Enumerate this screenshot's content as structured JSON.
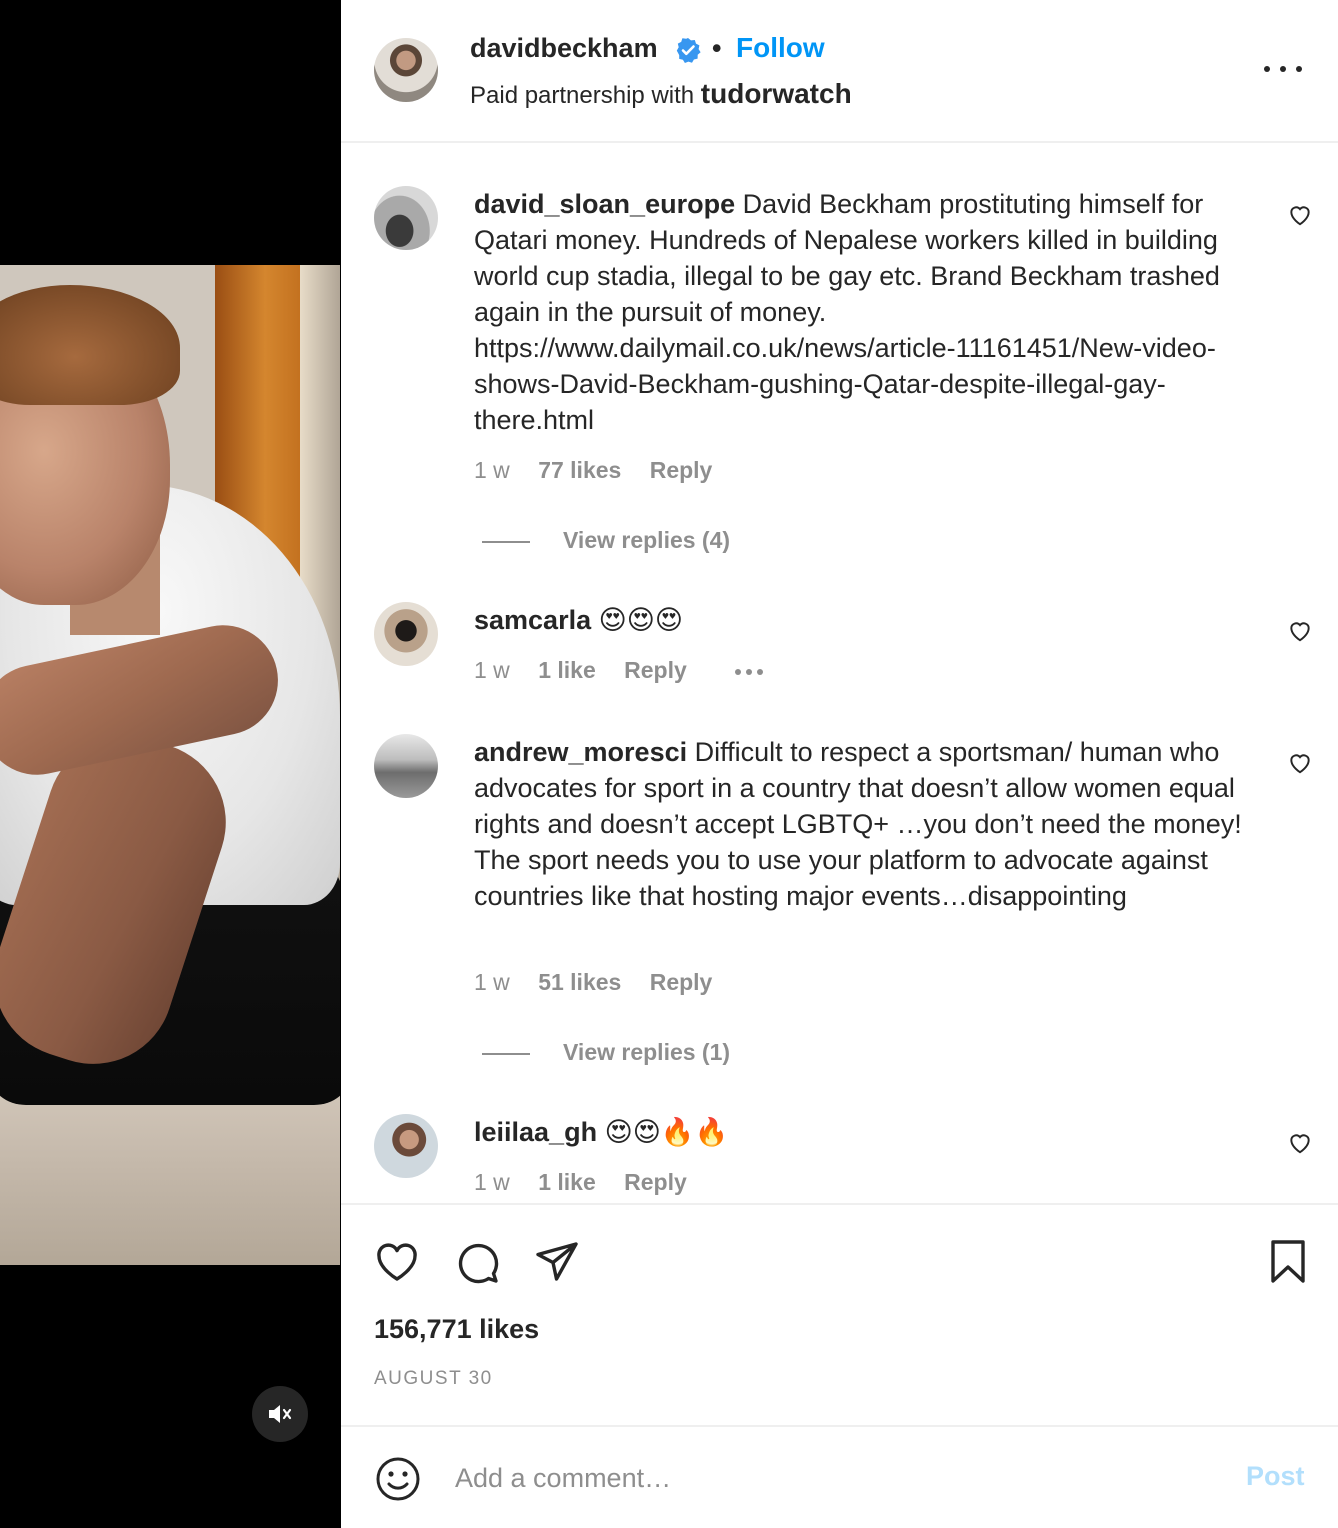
{
  "post": {
    "author": "davidbeckham",
    "follow_label": "Follow",
    "separator": "•",
    "partnership_prefix": "Paid partnership with",
    "partner": "tudorwatch"
  },
  "comments": [
    {
      "username": "david_sloan_europe",
      "text": "David Beckham prostituting himself for Qatari money. Hundreds of Nepalese workers killed in building world cup stadia, illegal to be gay etc. Brand Beckham trashed again in the pursuit of money. https://www.dailymail.co.uk/news/article-11161451/New-video-shows-David-Beckham-gushing-Qatar-despite-illegal-gay-there.html",
      "time": "1 w",
      "likes": "77 likes",
      "reply_label": "Reply",
      "view_replies": "View replies (4)"
    },
    {
      "username": "samcarla",
      "text": "😍😍😍",
      "time": "1 w",
      "likes": "1 like",
      "reply_label": "Reply"
    },
    {
      "username": "andrew_moresci",
      "text": "Difficult to respect a sportsman/ human who advocates for sport in a country that doesn’t allow women equal rights and doesn’t accept LGBTQ+ …you don’t need the money! The sport needs you to use your platform to advocate against countries like that hosting major events…disappointing",
      "time": "1 w",
      "likes": "51 likes",
      "reply_label": "Reply",
      "view_replies": "View replies (1)"
    },
    {
      "username": "leiilaa_gh",
      "text": "😍😍🔥🔥",
      "time": "1 w",
      "likes": "1 like",
      "reply_label": "Reply"
    }
  ],
  "stats": {
    "likes": "156,771 likes",
    "date": "AUGUST 30"
  },
  "composer": {
    "placeholder": "Add a comment…",
    "post_label": "Post"
  },
  "icons": {
    "verified": "verified-badge-icon",
    "more": "more-options-icon",
    "like": "heart-icon",
    "comment": "comment-bubble-icon",
    "share": "paper-plane-icon",
    "save": "bookmark-icon",
    "emoji": "emoji-icon",
    "mute": "muted-speaker-icon"
  },
  "colors": {
    "accent": "#0095f6",
    "post_disabled": "#b2dffc",
    "muted_text": "#8e8e8e",
    "text": "#262626"
  }
}
